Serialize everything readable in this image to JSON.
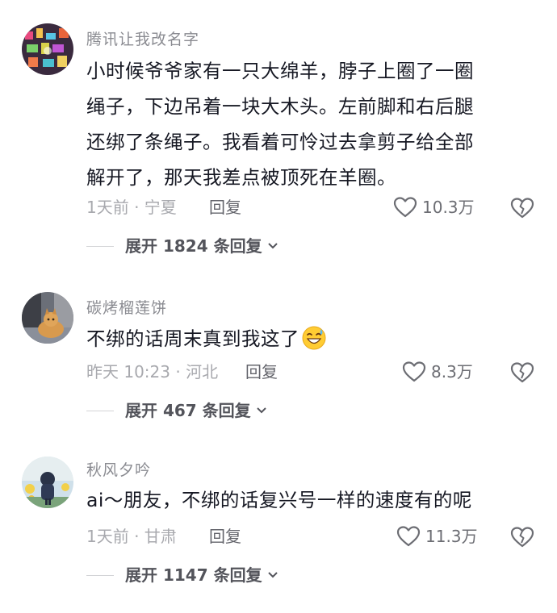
{
  "comments": [
    {
      "username": "腾讯让我改名字",
      "lines": [
        "小时候爷爷家有一只大绵羊，脖子上圈了一圈",
        "绳子，下边吊着一块大木头。左前脚和右后腿",
        "还绑了条绳子。我看着可怜过去拿剪子给全部",
        "解开了，那天我差点被顶死在羊圈。"
      ],
      "meta": "1天前 · 宁夏",
      "reply_label": "回复",
      "likes": "10.3万",
      "expand_label": "展开 1824 条回复"
    },
    {
      "username": "碳烤榴莲饼",
      "lines": [
        "不绑的话周末真到我这了"
      ],
      "emoji": "grinning-sweat-emoji",
      "meta": "昨天 10:23 · 河北",
      "reply_label": "回复",
      "likes": "8.3万",
      "expand_label": "展开 467 条回复"
    },
    {
      "username": "秋风夕吟",
      "lines": [
        "ai～朋友，不绑的话复兴号一样的速度有的呢"
      ],
      "meta": "1天前 · 甘肃",
      "reply_label": "回复",
      "likes": "11.3万",
      "expand_label": "展开 1147 条回复"
    }
  ],
  "icons": {
    "like": "heart-outline-icon",
    "dislike": "broken-heart-icon",
    "expand": "chevron-down-icon"
  },
  "colors": {
    "text": "#161823",
    "username": "#8a8b91",
    "meta": "#a8a9ae",
    "icon": "#6c6d73"
  }
}
